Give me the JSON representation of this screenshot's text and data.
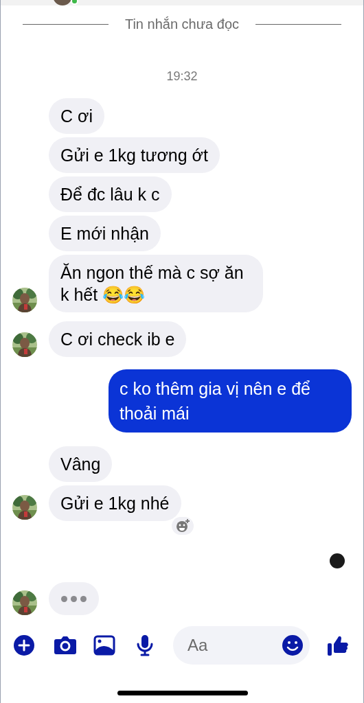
{
  "divider": {
    "label": "Tin nhắn chưa đọc"
  },
  "timestamp": "19:32",
  "items": [
    {
      "kind": "incoming",
      "text": "C ơi",
      "avatar": false,
      "reaction_button": false
    },
    {
      "kind": "incoming",
      "text": "Gửi e 1kg tương ớt",
      "avatar": false,
      "reaction_button": false
    },
    {
      "kind": "incoming",
      "text": "Để đc lâu k c",
      "avatar": false,
      "reaction_button": false
    },
    {
      "kind": "incoming",
      "text": "E mới nhận",
      "avatar": false,
      "reaction_button": false
    },
    {
      "kind": "incoming",
      "text": "Ăn ngon thế mà c sợ ăn k hết 😂😂",
      "avatar": true,
      "reaction_button": false
    },
    {
      "kind": "incoming",
      "text": "C ơi check ib e",
      "avatar": true,
      "reaction_button": false
    },
    {
      "kind": "outgoing",
      "text": "c ko thêm gia vị nên e để thoải mái"
    },
    {
      "kind": "incoming",
      "text": "Vâng",
      "avatar": false,
      "reaction_button": false
    },
    {
      "kind": "incoming",
      "text": "Gửi e 1kg nhé",
      "avatar": true,
      "reaction_button": true
    },
    {
      "kind": "seen"
    },
    {
      "kind": "typing",
      "avatar": true
    }
  ],
  "composer": {
    "placeholder": "Aa"
  }
}
